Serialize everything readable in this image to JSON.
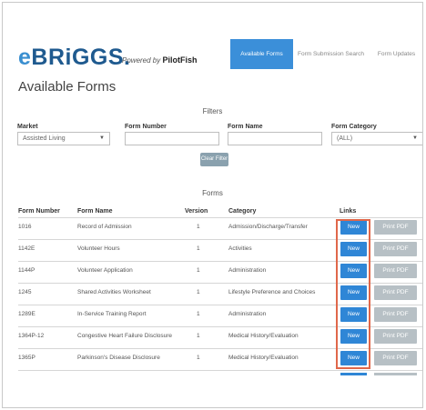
{
  "brand": {
    "logo_e": "e",
    "logo_rest": "BRiGGS.",
    "powered_prefix": "Powered by ",
    "powered_name": "PilotFish"
  },
  "nav": {
    "items": [
      "Available Forms",
      "Form Submission Search",
      "Form Updates"
    ],
    "active": "Available Forms"
  },
  "page": {
    "title": "Available Forms"
  },
  "filters": {
    "title": "Filters",
    "labels": {
      "market": "Market",
      "form_number": "Form Number",
      "form_name": "Form Name",
      "form_category": "Form Category"
    },
    "values": {
      "market": "Assisted Living",
      "form_number": "",
      "form_name": "",
      "form_category": "(ALL)"
    },
    "clear_label": "Clear Filter"
  },
  "forms": {
    "title": "Forms",
    "columns": [
      "Form Number",
      "Form Name",
      "Version",
      "Category",
      "Links"
    ],
    "new_label": "New",
    "pdf_label": "Print PDF",
    "rows": [
      {
        "number": "1016",
        "name": "Record of Admission",
        "version": "1",
        "category": "Admission/Discharge/Transfer"
      },
      {
        "number": "1142E",
        "name": "Volunteer Hours",
        "version": "1",
        "category": "Activities"
      },
      {
        "number": "1144P",
        "name": "Volunteer Application",
        "version": "1",
        "category": "Administration"
      },
      {
        "number": "1245",
        "name": "Shared Activities Worksheet",
        "version": "1",
        "category": "Lifestyle Preference and Choices"
      },
      {
        "number": "1289E",
        "name": "In-Service Training Report",
        "version": "1",
        "category": "Administration"
      },
      {
        "number": "1364P-12",
        "name": "Congestive Heart Failure Disclosure",
        "version": "1",
        "category": "Medical History/Evaluation"
      },
      {
        "number": "1365P",
        "name": "Parkinson's Disease Disclosure",
        "version": "1",
        "category": "Medical History/Evaluation"
      }
    ]
  },
  "colors": {
    "brand_light": "#3a8fd0",
    "brand_dark": "#1f5a8f",
    "nav_active": "#3b8fd9",
    "new_button": "#2f86d6",
    "pdf_button": "#b7c0c5",
    "highlight": "#e0674a"
  }
}
